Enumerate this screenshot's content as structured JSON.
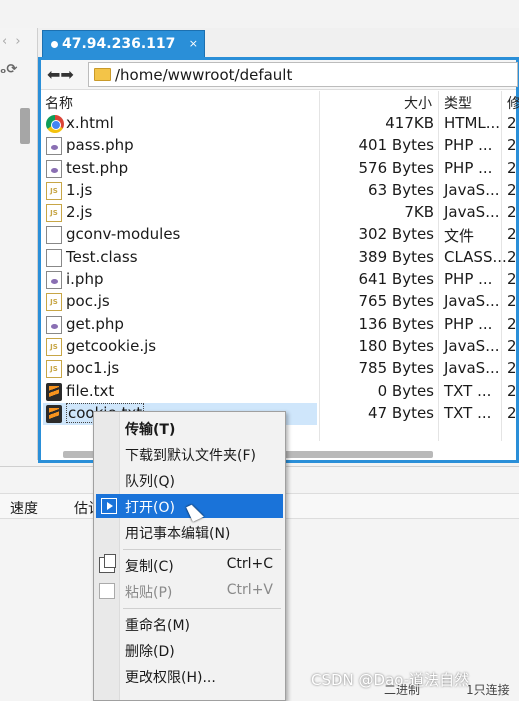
{
  "tab": {
    "title": "47.94.236.117",
    "close": "×"
  },
  "left": {
    "arrows": "‹ ›",
    "tools": "ₒ⟳"
  },
  "address": {
    "path": "/home/wwwroot/default"
  },
  "columns": {
    "name": "名称",
    "size": "大小",
    "type": "类型",
    "mod": "修"
  },
  "files": [
    {
      "name": "x.html",
      "size": "417KB",
      "type": "HTML...",
      "mod": "2",
      "icon": "chrome-icon"
    },
    {
      "name": "pass.php",
      "size": "401 Bytes",
      "type": "PHP ...",
      "mod": "2",
      "icon": "php-icon"
    },
    {
      "name": "test.php",
      "size": "576 Bytes",
      "type": "PHP ...",
      "mod": "2",
      "icon": "php-icon"
    },
    {
      "name": "1.js",
      "size": "63 Bytes",
      "type": "JavaS...",
      "mod": "2",
      "icon": "js-icon"
    },
    {
      "name": "2.js",
      "size": "7KB",
      "type": "JavaS...",
      "mod": "2",
      "icon": "js-icon"
    },
    {
      "name": "gconv-modules",
      "size": "302 Bytes",
      "type": "文件",
      "mod": "2",
      "icon": "file-icon"
    },
    {
      "name": "Test.class",
      "size": "389 Bytes",
      "type": "CLASS...",
      "mod": "2",
      "icon": "file-icon"
    },
    {
      "name": "i.php",
      "size": "641 Bytes",
      "type": "PHP ...",
      "mod": "2",
      "icon": "php-icon"
    },
    {
      "name": "poc.js",
      "size": "765 Bytes",
      "type": "JavaS...",
      "mod": "2",
      "icon": "js-icon"
    },
    {
      "name": "get.php",
      "size": "136 Bytes",
      "type": "PHP ...",
      "mod": "2",
      "icon": "php-icon"
    },
    {
      "name": "getcookie.js",
      "size": "180 Bytes",
      "type": "JavaS...",
      "mod": "2",
      "icon": "js-icon"
    },
    {
      "name": "poc1.js",
      "size": "785 Bytes",
      "type": "JavaS...",
      "mod": "2",
      "icon": "js-icon"
    },
    {
      "name": "file.txt",
      "size": "0 Bytes",
      "type": "TXT ...",
      "mod": "2",
      "icon": "sublime-icon"
    },
    {
      "name": "cookie.txt",
      "size": "47 Bytes",
      "type": "TXT ...",
      "mod": "2",
      "icon": "sublime-icon",
      "selected": true
    }
  ],
  "queue": {
    "speed": "速度",
    "eta": "估计",
    "footer_left": "二进制",
    "footer_right": "1只连接"
  },
  "menu": {
    "transfer": "传输(T)",
    "download_default": "下载到默认文件夹(F)",
    "queue": "队列(Q)",
    "open": "打开(O)",
    "notepad": "用记事本编辑(N)",
    "copy": "复制(C)",
    "copy_sc": "Ctrl+C",
    "paste": "粘贴(P)",
    "paste_sc": "Ctrl+V",
    "rename": "重命名(M)",
    "delete": "删除(D)",
    "chmod": "更改权限(H)..."
  },
  "watermark": "CSDN @Dao-道法自然"
}
